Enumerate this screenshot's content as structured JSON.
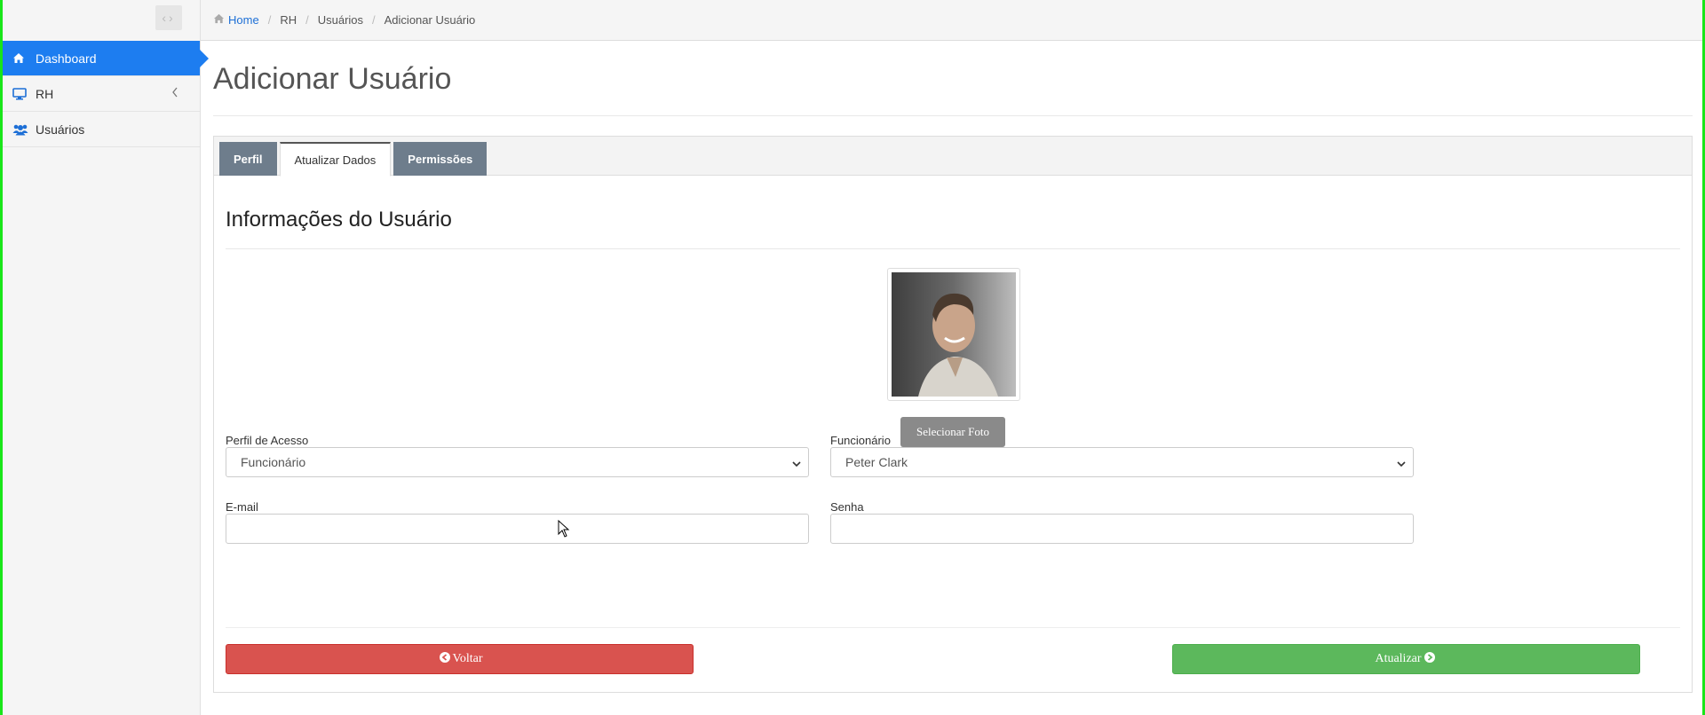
{
  "sidebar": {
    "toggle_icon": "code-arrows-icon",
    "items": [
      {
        "label": "Dashboard",
        "icon": "home-icon",
        "active": true
      },
      {
        "label": "RH",
        "icon": "monitor-icon",
        "chevron": "chevron-left-icon"
      },
      {
        "label": "Usuários",
        "icon": "users-icon"
      }
    ]
  },
  "breadcrumb": {
    "items": [
      "Home",
      "RH",
      "Usuários",
      "Adicionar Usuário"
    ],
    "separator": "/"
  },
  "page": {
    "title": "Adicionar Usuário"
  },
  "tabs": [
    {
      "label": "Perfil",
      "active": false
    },
    {
      "label": "Atualizar Dados",
      "active": true
    },
    {
      "label": "Permissões",
      "active": false
    }
  ],
  "form": {
    "section_title": "Informações do Usuário",
    "photo_button": "Selecionar Foto",
    "perfil_label": "Perfil de Acesso",
    "perfil_value": "Funcionário",
    "funcionario_label": "Funcionário",
    "funcionario_value": "Peter Clark",
    "email_label": "E-mail",
    "email_value": "",
    "senha_label": "Senha",
    "senha_value": "",
    "back_button": "Voltar",
    "update_button": "Atualizar"
  },
  "colors": {
    "active_nav": "#1d7df0",
    "tab_dark": "#6e7d8c",
    "danger": "#d9534f",
    "success": "#5cb85c",
    "frame": "#19e619"
  }
}
